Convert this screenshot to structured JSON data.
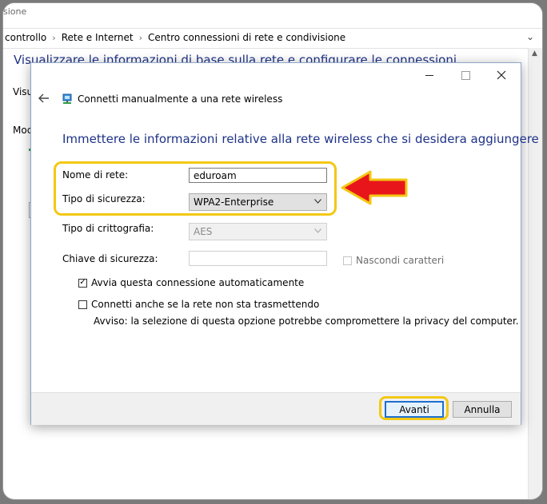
{
  "background_window": {
    "title_fragment": "sione",
    "breadcrumb": [
      "controllo",
      "Rete e Internet",
      "Centro connessioni di rete e condivisione"
    ],
    "heading": "Visualizzare le informazioni di base sulla rete e configurare le connessioni",
    "stub_1": "Visu",
    "stub_2": "Moc"
  },
  "dialog": {
    "title": "Connetti manualmente a una rete wireless",
    "heading": "Immettere le informazioni relative alla rete wireless che si desidera aggiungere",
    "fields": {
      "network_name_label": "Nome di rete:",
      "network_name_value": "eduroam",
      "security_type_label": "Tipo di sicurezza:",
      "security_type_value": "WPA2-Enterprise",
      "encryption_type_label": "Tipo di crittografia:",
      "encryption_type_value": "AES",
      "security_key_label": "Chiave di sicurezza:",
      "security_key_value": ""
    },
    "hide_characters": {
      "label": "Nascondi caratteri",
      "checked": false
    },
    "options": {
      "auto_connect": {
        "label": "Avvia questa connessione automaticamente",
        "checked": true
      },
      "connect_hidden": {
        "label": "Connetti anche se la rete non sta trasmettendo",
        "checked": false
      },
      "warning": "Avviso: la selezione di questa opzione potrebbe compromettere la privacy del computer."
    },
    "buttons": {
      "next": "Avanti",
      "cancel": "Annulla"
    }
  },
  "glyphs": {
    "check": "✓"
  },
  "colors": {
    "heading_blue": "#1e3287",
    "highlight_yellow": "#f3c814",
    "arrow_red": "#e8161b",
    "focus_blue": "#1b6fd1"
  }
}
